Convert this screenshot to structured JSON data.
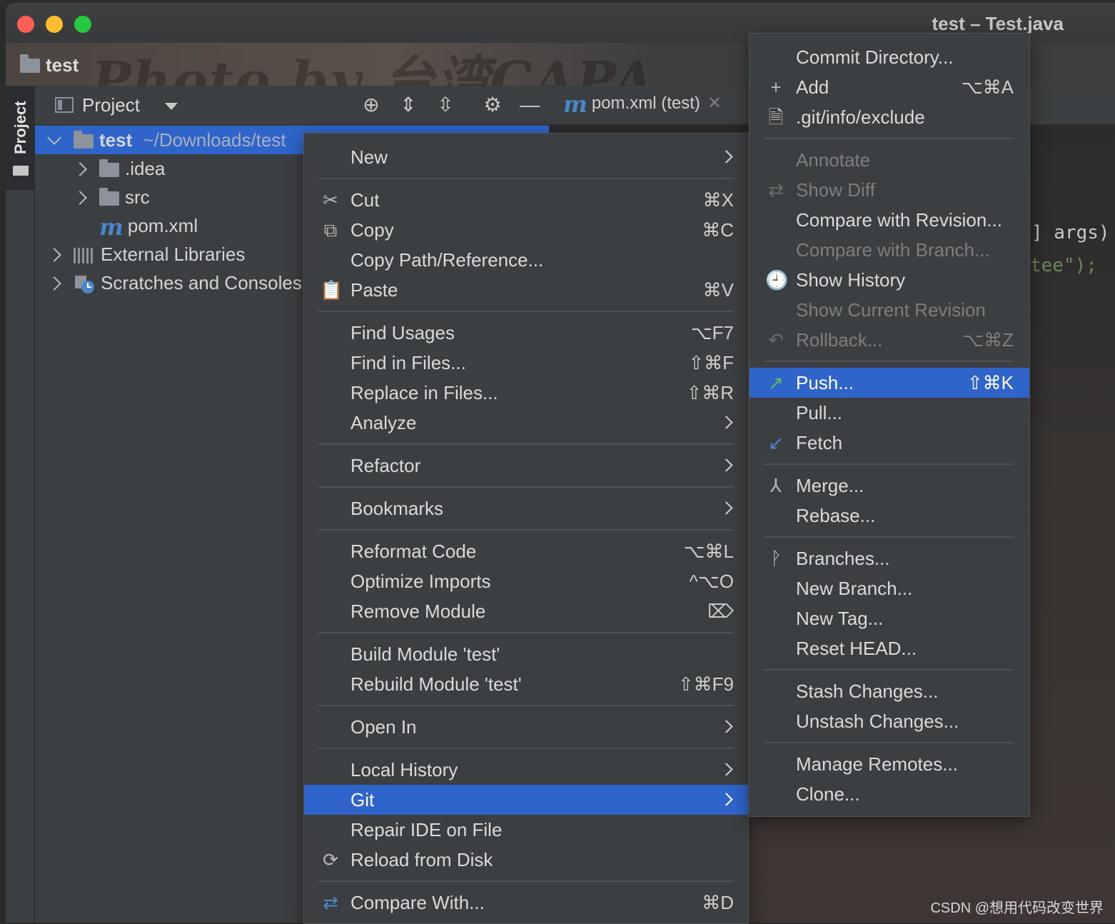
{
  "window": {
    "title": "test – Test.java"
  },
  "navbar": {
    "project_name": "test",
    "watermark": "Photo by 台湾CAPA"
  },
  "toolstrip": {
    "project_tab": "Project"
  },
  "project_panel": {
    "view_label": "Project",
    "tree": [
      {
        "label": "test",
        "path": "~/Downloads/test"
      },
      {
        "label": ".idea"
      },
      {
        "label": "src"
      },
      {
        "label": "pom.xml"
      },
      {
        "label": "External Libraries"
      },
      {
        "label": "Scratches and Consoles"
      }
    ]
  },
  "editor": {
    "tab_label": "pom.xml (test)",
    "code_args": "] args)",
    "code_tee": "tee\");"
  },
  "context_menu": {
    "items": [
      {
        "label": "New"
      },
      {
        "label": "Cut",
        "shortcut": "⌘X"
      },
      {
        "label": "Copy",
        "shortcut": "⌘C"
      },
      {
        "label": "Copy Path/Reference..."
      },
      {
        "label": "Paste",
        "shortcut": "⌘V"
      },
      {
        "label": "Find Usages",
        "shortcut": "⌥F7"
      },
      {
        "label": "Find in Files...",
        "shortcut": "⇧⌘F"
      },
      {
        "label": "Replace in Files...",
        "shortcut": "⇧⌘R"
      },
      {
        "label": "Analyze"
      },
      {
        "label": "Refactor"
      },
      {
        "label": "Bookmarks"
      },
      {
        "label": "Reformat Code",
        "shortcut": "⌥⌘L"
      },
      {
        "label": "Optimize Imports",
        "shortcut": "^⌥O"
      },
      {
        "label": "Remove Module",
        "shortcut": "⌦"
      },
      {
        "label": "Build Module 'test'"
      },
      {
        "label": "Rebuild Module 'test'",
        "shortcut": "⇧⌘F9"
      },
      {
        "label": "Open In"
      },
      {
        "label": "Local History"
      },
      {
        "label": "Git"
      },
      {
        "label": "Repair IDE on File"
      },
      {
        "label": "Reload from Disk"
      },
      {
        "label": "Compare With...",
        "shortcut": "⌘D"
      }
    ]
  },
  "git_menu": {
    "items": [
      {
        "label": "Commit Directory..."
      },
      {
        "label": "Add",
        "shortcut": "⌥⌘A"
      },
      {
        "label": ".git/info/exclude"
      },
      {
        "label": "Annotate"
      },
      {
        "label": "Show Diff"
      },
      {
        "label": "Compare with Revision..."
      },
      {
        "label": "Compare with Branch..."
      },
      {
        "label": "Show History"
      },
      {
        "label": "Show Current Revision"
      },
      {
        "label": "Rollback...",
        "shortcut": "⌥⌘Z"
      },
      {
        "label": "Push...",
        "shortcut": "⇧⌘K"
      },
      {
        "label": "Pull..."
      },
      {
        "label": "Fetch"
      },
      {
        "label": "Merge..."
      },
      {
        "label": "Rebase..."
      },
      {
        "label": "Branches..."
      },
      {
        "label": "New Branch..."
      },
      {
        "label": "New Tag..."
      },
      {
        "label": "Reset HEAD..."
      },
      {
        "label": "Stash Changes..."
      },
      {
        "label": "Unstash Changes..."
      },
      {
        "label": "Manage Remotes..."
      },
      {
        "label": "Clone..."
      }
    ]
  },
  "footer": {
    "watermark": "CSDN @想用代码改变世界"
  },
  "colors": {
    "highlight": "#2f65ca",
    "menu_bg": "#3c3f41",
    "accent_blue": "#4a86c8",
    "push_green": "#5fb95f"
  }
}
